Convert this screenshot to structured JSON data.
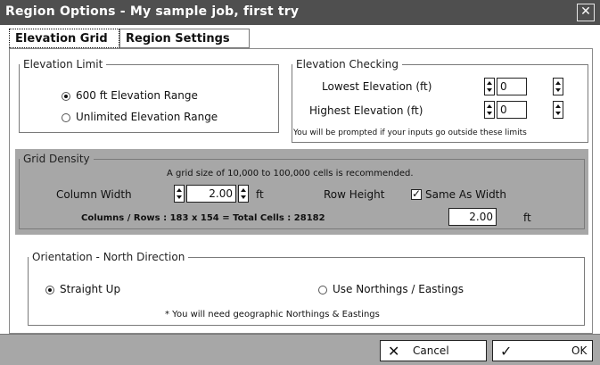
{
  "window": {
    "title": "Region Options - My sample job, first try",
    "close_icon": "close-icon"
  },
  "tabs": [
    {
      "label": "Elevation Grid"
    },
    {
      "label": "Region Settings"
    }
  ],
  "elevation_limit": {
    "legend": "Elevation Limit",
    "option1": "600 ft Elevation Range",
    "option2": "Unlimited Elevation Range"
  },
  "elevation_checking": {
    "legend": "Elevation Checking",
    "lowest_label": "Lowest Elevation (ft)",
    "lowest_value": "0",
    "highest_label": "Highest Elevation (ft)",
    "highest_value": "0",
    "note": "You will be prompted if your inputs go outside these limits"
  },
  "grid_density": {
    "legend": "Grid Density",
    "hint": "A grid size of 10,000 to 100,000 cells is recommended.",
    "column_width_label": "Column Width",
    "column_width_value": "2.00",
    "column_width_unit": "ft",
    "row_height_label": "Row Height",
    "same_as_width_label": "Same As Width",
    "row_height_value": "2.00",
    "row_height_unit": "ft",
    "summary": "Columns / Rows : 183 x 154 = Total Cells : 28182"
  },
  "orientation": {
    "legend": "Orientation - North Direction",
    "option1": "Straight Up",
    "option2": "Use Northings / Eastings",
    "note": "* You will need geographic Northings & Eastings"
  },
  "buttons": {
    "cancel": "Cancel",
    "ok": "OK"
  }
}
